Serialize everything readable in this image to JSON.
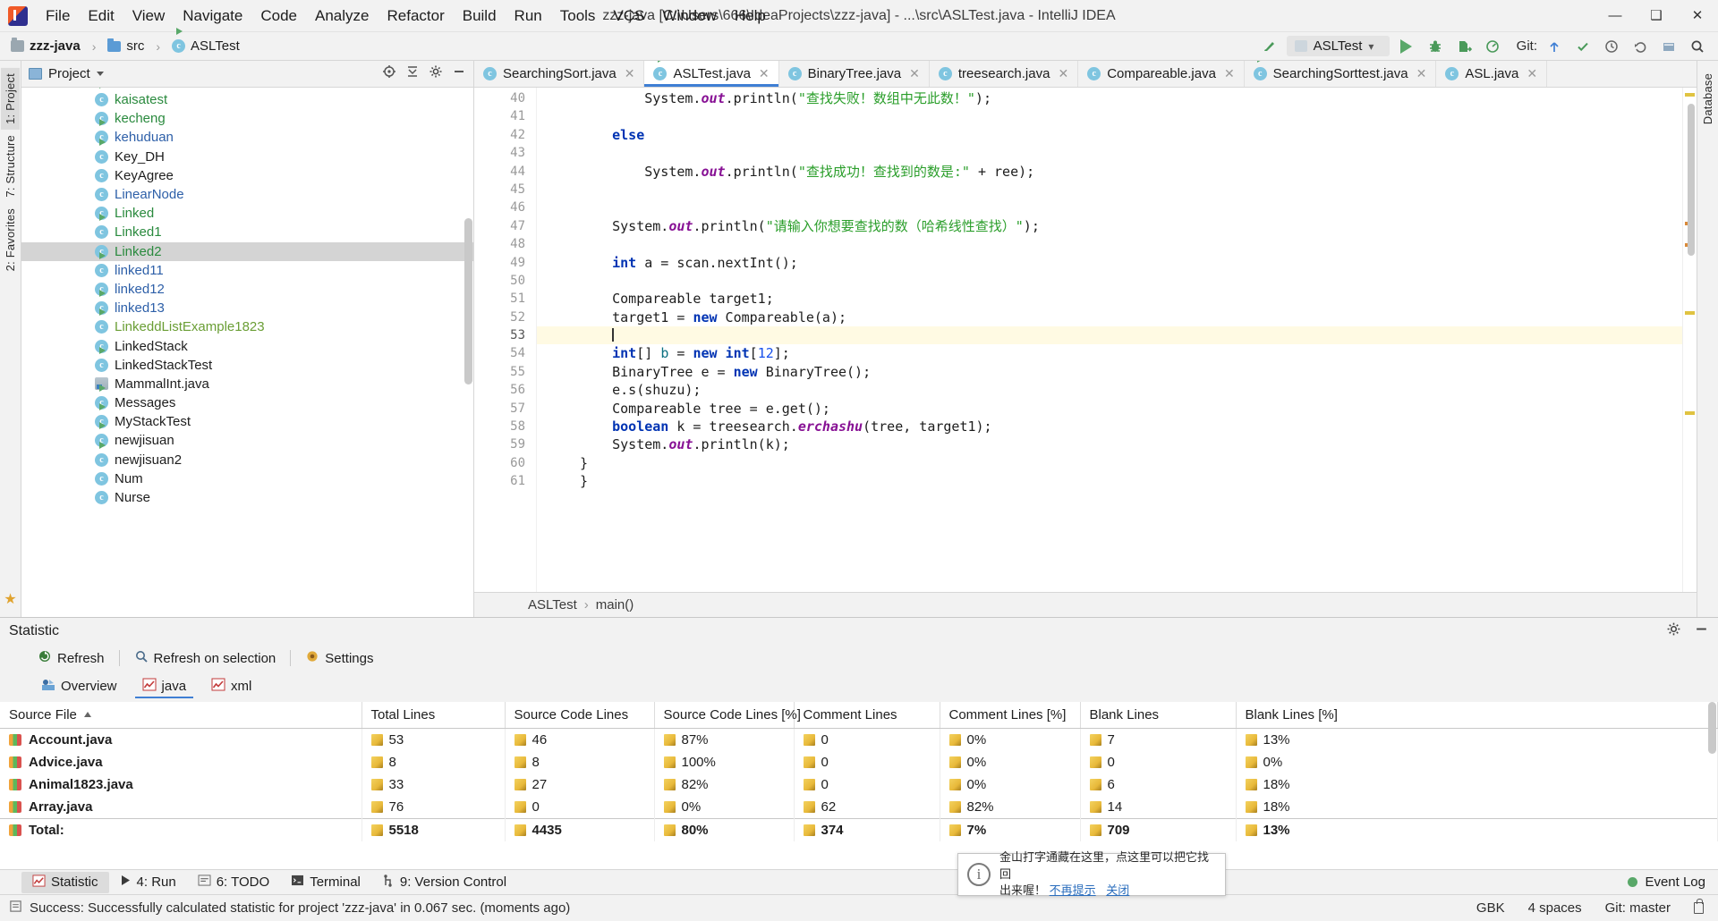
{
  "window": {
    "title": "zzz-java [C:\\Users\\666\\IdeaProjects\\zzz-java] - ...\\src\\ASLTest.java - IntelliJ IDEA",
    "minimize_glyph": "—",
    "maximize_glyph": "❑",
    "close_glyph": "✕"
  },
  "menu": {
    "items": [
      "File",
      "Edit",
      "View",
      "Navigate",
      "Code",
      "Analyze",
      "Refactor",
      "Build",
      "Run",
      "Tools",
      "VCS",
      "Window",
      "Help"
    ]
  },
  "breadcrumb": {
    "project": "zzz-java",
    "folder": "src",
    "file": "ASLTest",
    "separator": "›"
  },
  "toolbar": {
    "run_config": "ASLTest",
    "chevron": "⌄",
    "git_label": "Git:",
    "search_icon": "search-icon",
    "run_icon": "run-icon",
    "debug_icon": "debug-icon",
    "coverage_icon": "coverage-icon"
  },
  "project_panel": {
    "title": "Project",
    "items": [
      {
        "label": "kaisatest",
        "color": "#2a8a3e",
        "runnable": true
      },
      {
        "label": "kecheng",
        "color": "#2a8a3e",
        "runnable": false
      },
      {
        "label": "kehuduan",
        "color": "#2d5fa8",
        "runnable": true
      },
      {
        "label": "Key_DH",
        "color": "#1d1d1d",
        "runnable": true
      },
      {
        "label": "KeyAgree",
        "color": "#1d1d1d",
        "runnable": false
      },
      {
        "label": "LinearNode",
        "color": "#2d5fa8",
        "runnable": false
      },
      {
        "label": "Linked",
        "color": "#2a8a3e",
        "runnable": false
      },
      {
        "label": "Linked1",
        "color": "#2a8a3e",
        "runnable": true
      },
      {
        "label": "Linked2",
        "color": "#2a8a3e",
        "runnable": false,
        "selected": true
      },
      {
        "label": "linked11",
        "color": "#2d5fa8",
        "runnable": true
      },
      {
        "label": "linked12",
        "color": "#2d5fa8",
        "runnable": false
      },
      {
        "label": "linked13",
        "color": "#2d5fa8",
        "runnable": true
      },
      {
        "label": "LinkeddListExample1823",
        "color": "#6a9e35",
        "runnable": true
      },
      {
        "label": "LinkedStack",
        "color": "#1d1d1d",
        "runnable": false
      },
      {
        "label": "LinkedStackTest",
        "color": "#1d1d1d",
        "runnable": true
      },
      {
        "label": "MammalInt.java",
        "color": "#1d1d1d",
        "runnable": false,
        "kind": "java-file"
      },
      {
        "label": "Messages",
        "color": "#1d1d1d",
        "runnable": true
      },
      {
        "label": "MyStackTest",
        "color": "#1d1d1d",
        "runnable": true
      },
      {
        "label": "newjisuan",
        "color": "#1d1d1d",
        "runnable": true
      },
      {
        "label": "newjisuan2",
        "color": "#1d1d1d",
        "runnable": true
      },
      {
        "label": "Num",
        "color": "#1d1d1d",
        "runnable": false
      },
      {
        "label": "Nurse",
        "color": "#1d1d1d",
        "runnable": false
      }
    ]
  },
  "editor": {
    "tabs": [
      {
        "label": "SearchingSort.java",
        "active": false,
        "runnable": false
      },
      {
        "label": "ASLTest.java",
        "active": true,
        "runnable": true
      },
      {
        "label": "BinaryTree.java",
        "active": false,
        "runnable": false
      },
      {
        "label": "treesearch.java",
        "active": false,
        "runnable": false
      },
      {
        "label": "Compareable.java",
        "active": false,
        "runnable": false
      },
      {
        "label": "SearchingSorttest.java",
        "active": false,
        "runnable": true
      },
      {
        "label": "ASL.java",
        "active": false,
        "runnable": false
      }
    ],
    "tab_close_glyph": "✕",
    "first_line_number": 40,
    "current_line": 53,
    "lines": [
      {
        "n": 40,
        "html": "        <span class=\"plain\">System.</span><span class=\"fld\">out</span><span class=\"plain\">.println(</span><span class=\"st\">\"查找失败！数组中无此数！\"</span><span class=\"plain\">);</span>"
      },
      {
        "n": 41,
        "html": ""
      },
      {
        "n": 42,
        "html": "    <span class=\"kw\">else</span>"
      },
      {
        "n": 43,
        "html": ""
      },
      {
        "n": 44,
        "html": "        <span class=\"plain\">System.</span><span class=\"fld\">out</span><span class=\"plain\">.println(</span><span class=\"st\">\"查找成功！查找到的数是:\"</span><span class=\"plain\"> + ree);</span>"
      },
      {
        "n": 45,
        "html": ""
      },
      {
        "n": 46,
        "html": ""
      },
      {
        "n": 47,
        "html": "    <span class=\"plain\">System.</span><span class=\"fld\">out</span><span class=\"plain\">.println(</span><span class=\"st\">\"请输入你想要查找的数（哈希线性查找）\"</span><span class=\"plain\">);</span>"
      },
      {
        "n": 48,
        "html": ""
      },
      {
        "n": 49,
        "html": "    <span class=\"kw\">int</span><span class=\"plain\"> a = scan.nextInt();</span>"
      },
      {
        "n": 50,
        "html": ""
      },
      {
        "n": 51,
        "html": "    <span class=\"plain\">Compareable target1;</span>"
      },
      {
        "n": 52,
        "html": "    <span class=\"plain\">target1 = </span><span class=\"kw\">new</span><span class=\"plain\"> Compareable(a);</span>"
      },
      {
        "n": 53,
        "html": "    <span class=\"caret-bar\"></span>",
        "current": true
      },
      {
        "n": 54,
        "html": "    <span class=\"kw\">int</span><span class=\"plain\">[] </span><span class=\"local\">b</span><span class=\"plain\"> = </span><span class=\"kw\">new</span><span class=\"plain\"> </span><span class=\"kw\">int</span><span class=\"plain\">[</span><span class=\"num\">12</span><span class=\"plain\">];</span>"
      },
      {
        "n": 55,
        "html": "    <span class=\"plain\">BinaryTree e = </span><span class=\"kw\">new</span><span class=\"plain\"> BinaryTree();</span>"
      },
      {
        "n": 56,
        "html": "    <span class=\"plain\">e.s(shuzu);</span>"
      },
      {
        "n": 57,
        "html": "    <span class=\"plain\">Compareable tree = e.get();</span>"
      },
      {
        "n": 58,
        "html": "    <span class=\"kw\">boolean</span><span class=\"plain\"> k = treesearch.</span><span class=\"fld\">erchashu</span><span class=\"plain\">(tree, target1);</span>"
      },
      {
        "n": 59,
        "html": "    <span class=\"plain\">System.</span><span class=\"fld\">out</span><span class=\"plain\">.println(k);</span>"
      },
      {
        "n": 60,
        "html": "<span class=\"plain\">}</span>"
      },
      {
        "n": 61,
        "html": "<span class=\"plain\">}</span>"
      }
    ],
    "breadcrumb_class": "ASLTest",
    "breadcrumb_method": "main()",
    "breadcrumb_sep": "›"
  },
  "statistic": {
    "title": "Statistic",
    "toolbar": [
      {
        "label": "Refresh",
        "icon": "refresh-icon"
      },
      {
        "label": "Refresh on selection",
        "icon": "search-icon"
      },
      {
        "label": "Settings",
        "icon": "settings-icon"
      }
    ],
    "tabs": [
      {
        "label": "Overview",
        "icon": "overview-icon",
        "active": false
      },
      {
        "label": "java",
        "icon": "chart-icon",
        "active": true
      },
      {
        "label": "xml",
        "icon": "chart-icon",
        "active": false
      }
    ],
    "columns": [
      "Source File",
      "Total Lines",
      "Source Code Lines",
      "Source Code Lines [%]",
      "Comment Lines",
      "Comment Lines [%]",
      "Blank Lines",
      "Blank Lines [%]"
    ],
    "sorted_column": "Source File",
    "sort_direction": "asc",
    "rows": [
      {
        "file": "Account.java",
        "total": "53",
        "source": "46",
        "source_pct": "87%",
        "comment": "0",
        "comment_pct": "0%",
        "blank": "7",
        "blank_pct": "13%"
      },
      {
        "file": "Advice.java",
        "total": "8",
        "source": "8",
        "source_pct": "100%",
        "comment": "0",
        "comment_pct": "0%",
        "blank": "0",
        "blank_pct": "0%"
      },
      {
        "file": "Animal1823.java",
        "total": "33",
        "source": "27",
        "source_pct": "82%",
        "comment": "0",
        "comment_pct": "0%",
        "blank": "6",
        "blank_pct": "18%"
      },
      {
        "file": "Array.java",
        "total": "76",
        "source": "0",
        "source_pct": "0%",
        "comment": "62",
        "comment_pct": "82%",
        "blank": "14",
        "blank_pct": "18%"
      }
    ],
    "total_row": {
      "file": "Total:",
      "total": "5518",
      "source": "4435",
      "source_pct": "80%",
      "comment": "374",
      "comment_pct": "7%",
      "blank": "709",
      "blank_pct": "13%"
    }
  },
  "bottom_bar": {
    "items": [
      {
        "label": "Statistic",
        "icon": "statistic-icon",
        "active": true
      },
      {
        "label": "4: Run",
        "icon": "run-icon",
        "active": false
      },
      {
        "label": "6: TODO",
        "icon": "todo-icon",
        "active": false
      },
      {
        "label": "Terminal",
        "icon": "terminal-icon",
        "active": false
      },
      {
        "label": "9: Version Control",
        "icon": "branch-icon",
        "active": false
      }
    ],
    "event_log": "Event Log"
  },
  "status_bar": {
    "message": "Success: Successfully calculated statistic for project 'zzz-java' in 0.067 sec. (moments ago)",
    "encoding": "GBK",
    "indent": "4 spaces",
    "git_branch": "Git: master"
  },
  "notification": {
    "line1": "金山打字通藏在这里，点这里可以把它找回",
    "line2_prefix": "出来喔！",
    "link1": "不再提示",
    "link2": "关闭",
    "icon": "info-icon"
  },
  "left_strip": {
    "tabs": [
      {
        "label": "1: Project",
        "active": true
      },
      {
        "label": "7: Structure",
        "active": false
      },
      {
        "label": "2: Favorites",
        "active": false
      }
    ]
  },
  "right_strip": {
    "tabs": [
      {
        "label": "Database",
        "active": false
      }
    ]
  }
}
